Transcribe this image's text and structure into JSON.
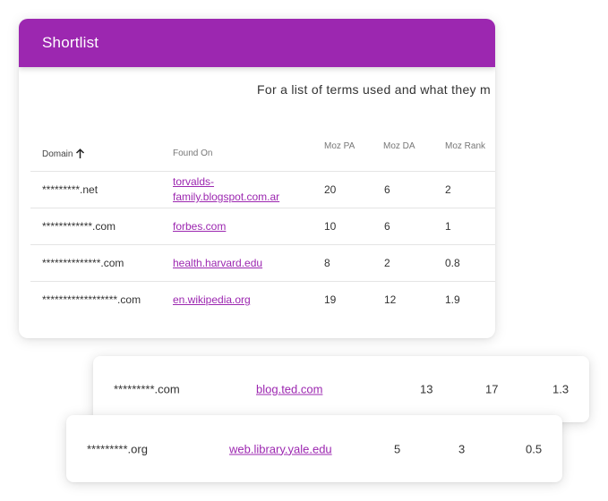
{
  "card": {
    "title": "Shortlist",
    "intro_text": "For a list of terms used and what they m"
  },
  "table": {
    "headers": {
      "domain": "Domain",
      "found_on": "Found On",
      "moz_pa": "Moz PA",
      "moz_da": "Moz DA",
      "moz_rank": "Moz Rank"
    },
    "sort_icon": "arrow-up-icon",
    "rows": [
      {
        "domain": "*********.net",
        "found_on": "torvalds-family.blogspot.com.ar",
        "moz_pa": "20",
        "moz_da": "6",
        "moz_rank": "2"
      },
      {
        "domain": "************.com",
        "found_on": "forbes.com",
        "moz_pa": "10",
        "moz_da": "6",
        "moz_rank": "1"
      },
      {
        "domain": "**************.com",
        "found_on": "health.harvard.edu",
        "moz_pa": "8",
        "moz_da": "2",
        "moz_rank": "0.8"
      },
      {
        "domain": "******************.com",
        "found_on": "en.wikipedia.org",
        "moz_pa": "19",
        "moz_da": "12",
        "moz_rank": "1.9"
      }
    ]
  },
  "floating_rows": [
    {
      "domain": "*********.com",
      "found_on": "blog.ted.com",
      "moz_pa": "13",
      "moz_da": "17",
      "moz_rank": "1.3"
    },
    {
      "domain": "*********.org",
      "found_on": "web.library.yale.edu",
      "moz_pa": "5",
      "moz_da": "3",
      "moz_rank": "0.5"
    }
  ],
  "colors": {
    "accent": "#9c27b0",
    "border": "#e4e4e4",
    "header_text": "#ffffff"
  }
}
